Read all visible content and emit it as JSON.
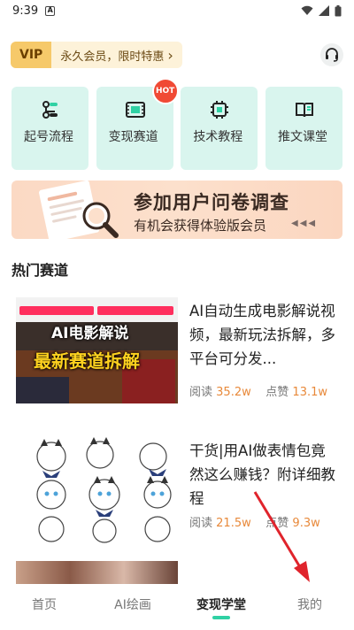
{
  "status_bar": {
    "time": "9:39",
    "notification_icon": "a-icon",
    "icons": [
      "wifi-icon",
      "signal-icon",
      "battery-icon"
    ]
  },
  "vip": {
    "tag": "VIP",
    "text": "永久会员，限时特惠",
    "chevron": "›"
  },
  "support_icon": "headset-icon",
  "features": [
    {
      "label": "起号流程",
      "icon": "flow-icon"
    },
    {
      "label": "变现赛道",
      "icon": "film-icon",
      "badge": "HOT"
    },
    {
      "label": "技术教程",
      "icon": "chip-icon"
    },
    {
      "label": "推文课堂",
      "icon": "book-icon"
    }
  ],
  "survey": {
    "title": "参加用户问卷调查",
    "subtitle": "有机会获得体验版会员",
    "arrows": "◀◀◀"
  },
  "section": {
    "title": "热门赛道"
  },
  "articles": [
    {
      "title": "AI自动生成电影解说视频，最新玩法拆解，多平台可分发...",
      "read_label": "阅读",
      "read_count": "35.2w",
      "like_label": "点赞",
      "like_count": "13.1w",
      "thumb_text_1": "AI电影解说",
      "thumb_text_2": "最新赛道拆解"
    },
    {
      "title": "干货|用AI做表情包竟然这么赚钱？附详细教程",
      "read_label": "阅读",
      "read_count": "21.5w",
      "like_label": "点赞",
      "like_count": "9.3w"
    }
  ],
  "nav": {
    "items": [
      {
        "label": "首页"
      },
      {
        "label": "AI绘画"
      },
      {
        "label": "变现学堂"
      },
      {
        "label": "我的"
      }
    ],
    "active_index": 2
  },
  "colors": {
    "accent": "#30d1a4",
    "card_bg": "#d9f5ee",
    "count": "#e8893a",
    "hot": "#f04a35",
    "arrow": "#e0242c"
  }
}
